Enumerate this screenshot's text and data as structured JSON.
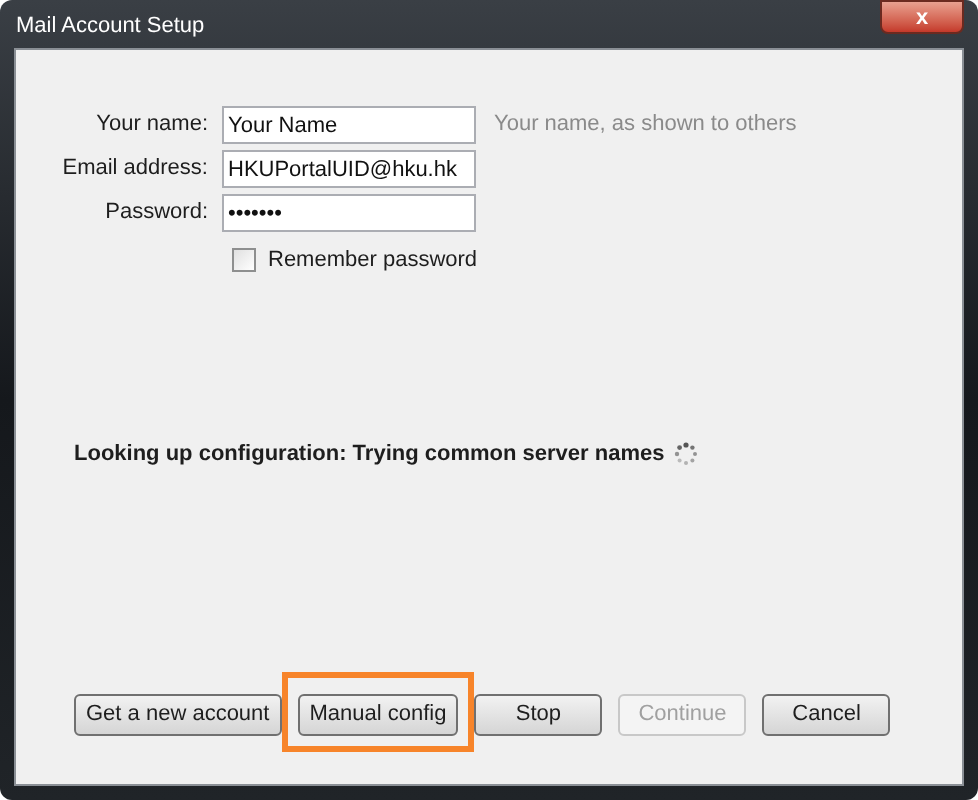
{
  "window": {
    "title": "Mail Account Setup",
    "close_label": "x"
  },
  "fields": [
    {
      "label": "Your name:",
      "value": "Your Name",
      "hint": "Your name, as shown to others"
    },
    {
      "label": "Email address:",
      "value": "HKUPortalUID@hku.hk"
    },
    {
      "label": "Password:",
      "value": "•••••••"
    }
  ],
  "remember_password": {
    "label": "Remember password",
    "checked": false
  },
  "status": "Looking up configuration: Trying common server names",
  "buttons": [
    {
      "label": "Get a new account",
      "disabled": false,
      "highlighted": false
    },
    {
      "label": "Manual config",
      "disabled": false,
      "highlighted": true
    },
    {
      "label": "Stop",
      "disabled": false,
      "highlighted": false
    },
    {
      "label": "Continue",
      "disabled": true,
      "highlighted": false
    },
    {
      "label": "Cancel",
      "disabled": false,
      "highlighted": false
    }
  ]
}
